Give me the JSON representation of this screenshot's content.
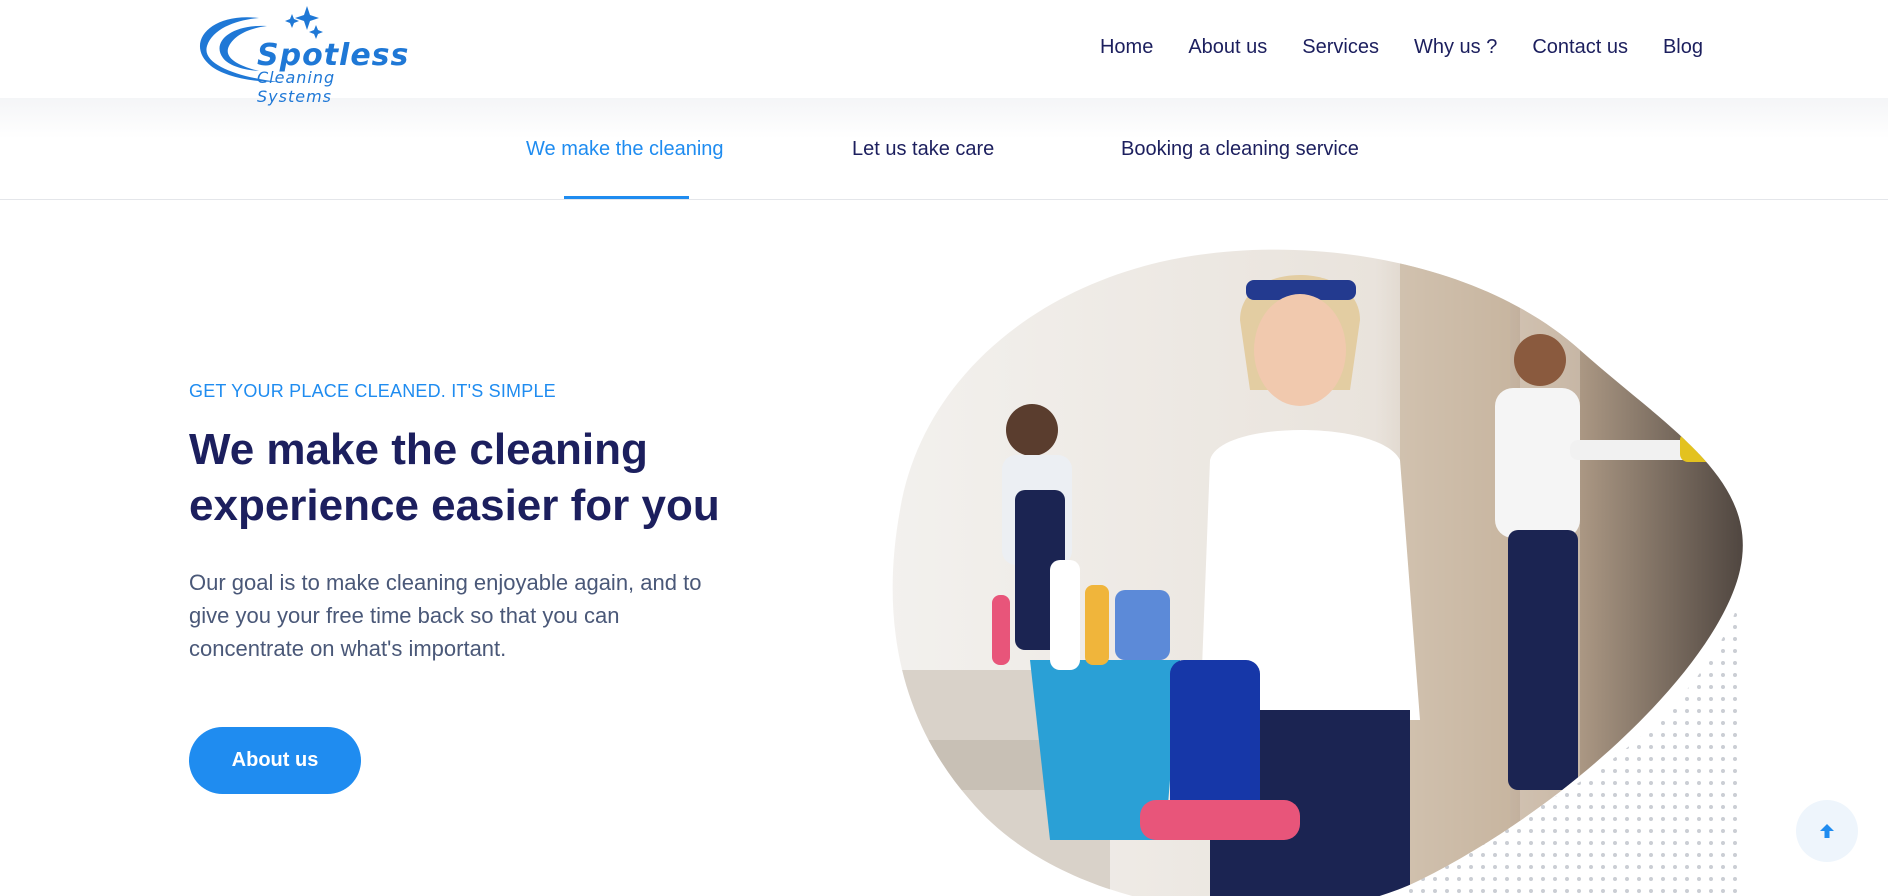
{
  "brand": {
    "name": "Spotless",
    "tagline": "Cleaning Systems",
    "color": "#1f78d6"
  },
  "nav": {
    "items": [
      {
        "label": "Home"
      },
      {
        "label": "About us"
      },
      {
        "label": "Services"
      },
      {
        "label": "Why us ?"
      },
      {
        "label": "Contact us"
      },
      {
        "label": "Blog"
      }
    ]
  },
  "tabs": [
    {
      "label": "We make the cleaning",
      "active": true
    },
    {
      "label": "Let us take care",
      "active": false
    },
    {
      "label": "Booking a cleaning service",
      "active": false
    }
  ],
  "hero": {
    "eyebrow": "GET YOUR PLACE CLEANED. IT'S SIMPLE",
    "headline": "We make the cleaning experience easier for you",
    "body": "Our goal is to make cleaning enjoyable again, and to give you your free time back so that you can concentrate on what's important.",
    "cta_label": "About us"
  },
  "scroll_top": {
    "icon": "arrow-up-icon"
  },
  "colors": {
    "accent": "#1f8cf0",
    "heading": "#1c1f5e",
    "body": "#4a5878"
  }
}
